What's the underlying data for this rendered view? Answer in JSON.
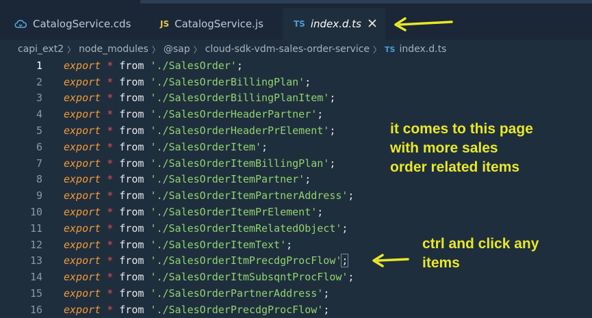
{
  "tabs": [
    {
      "label": "CatalogService.cds",
      "icon": "cloud-icon"
    },
    {
      "label": "CatalogService.js",
      "badge": "JS"
    },
    {
      "label": "index.d.ts",
      "badge": "TS",
      "active": true
    }
  ],
  "breadcrumb": {
    "segments": [
      "capi_ext2",
      "node_modules",
      "@sap",
      "cloud-sdk-vdm-sales-order-service"
    ],
    "file_badge": "TS",
    "file": "index.d.ts"
  },
  "code_tokens": {
    "export": "export",
    "star": "*",
    "from": "from"
  },
  "lines": [
    {
      "n": "1",
      "path": "'./SalesOrder'"
    },
    {
      "n": "2",
      "path": "'./SalesOrderBillingPlan'"
    },
    {
      "n": "3",
      "path": "'./SalesOrderBillingPlanItem'"
    },
    {
      "n": "4",
      "path": "'./SalesOrderHeaderPartner'"
    },
    {
      "n": "5",
      "path": "'./SalesOrderHeaderPrElement'"
    },
    {
      "n": "6",
      "path": "'./SalesOrderItem'"
    },
    {
      "n": "7",
      "path": "'./SalesOrderItemBillingPlan'"
    },
    {
      "n": "8",
      "path": "'./SalesOrderItemPartner'"
    },
    {
      "n": "9",
      "path": "'./SalesOrderItemPartnerAddress'"
    },
    {
      "n": "10",
      "path": "'./SalesOrderItemPrElement'"
    },
    {
      "n": "11",
      "path": "'./SalesOrderItemRelatedObject'"
    },
    {
      "n": "12",
      "path": "'./SalesOrderItemText'"
    },
    {
      "n": "13",
      "path": "'./SalesOrderItmPrecdgProcFlow'"
    },
    {
      "n": "14",
      "path": "'./SalesOrderItmSubsqntProcFlow'"
    },
    {
      "n": "15",
      "path": "'./SalesOrderPartnerAddress'"
    },
    {
      "n": "16",
      "path": "'./SalesOrderPrecdgProcFlow'"
    }
  ],
  "annotations": {
    "page_note": [
      "it comes to this page",
      "with more sales",
      "order related items"
    ],
    "click_note": [
      "ctrl and click any",
      "items"
    ],
    "color": "#e8e827"
  },
  "colors": {
    "background": "#1f2e3d",
    "keyword": "#f09a3a",
    "operator": "#e04b5d",
    "string": "#91d36f"
  }
}
